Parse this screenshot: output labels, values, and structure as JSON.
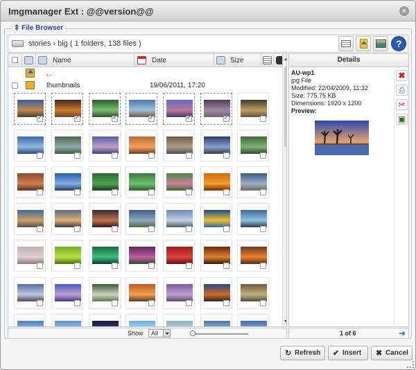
{
  "window": {
    "title": "Imgmanager Ext : @@version@@"
  },
  "browser": {
    "legend": "File Browser",
    "path": "stories › big ( 1 folders, 138 files )"
  },
  "columns": {
    "name": "Name",
    "date": "Date",
    "size": "Size"
  },
  "folders": {
    "up": "...",
    "thumbnails_name": "thumbnails",
    "thumbnails_date": "19/06/2011, 17:20"
  },
  "details": {
    "header": "Details",
    "name": "AU-wp1",
    "type": "jpg File",
    "modified": "Modified: 22/04/2009, 11:32",
    "size": "Size: 775.75 KB",
    "dimensions": "Dimensions: 1920 x 1200",
    "preview_label": "Preview:"
  },
  "status": {
    "show_label": "Show",
    "show_value": "All",
    "page": "1 of 6"
  },
  "buttons": {
    "refresh": "Refresh",
    "insert": "Insert",
    "cancel": "Cancel"
  },
  "colors": {
    "accent": "#1a4aa0",
    "delete": "#d42020"
  },
  "thumbnails": [
    {
      "g": [
        "#3a5d9c",
        "#c08a50",
        "#4a3a30"
      ],
      "sel": true
    },
    {
      "g": [
        "#3a2a1a",
        "#d07a30",
        "#6a4a20"
      ],
      "sel": true
    },
    {
      "g": [
        "#2a5a2a",
        "#7ac070",
        "#305030"
      ],
      "sel": true
    },
    {
      "g": [
        "#4a7ab0",
        "#a0c0d8",
        "#6a5a40"
      ],
      "sel": true
    },
    {
      "g": [
        "#5a6ac0",
        "#c07a9a",
        "#3a3a6a"
      ],
      "sel": true
    },
    {
      "g": [
        "#4a3a5a",
        "#a08aa0",
        "#706070"
      ],
      "sel": true
    },
    {
      "g": [
        "#3a3a2a",
        "#c0a060",
        "#605040"
      ],
      "sel": false
    },
    {
      "g": [
        "#3a6ab0",
        "#90b8e0",
        "#2a4a80"
      ],
      "sel": false
    },
    {
      "g": [
        "#4a6a4a",
        "#90a8b0",
        "#405a40"
      ],
      "sel": false
    },
    {
      "g": [
        "#5a5ab0",
        "#c0a0c0",
        "#404080"
      ],
      "sel": false
    },
    {
      "g": [
        "#c06a30",
        "#f0a060",
        "#6a3a20"
      ],
      "sel": false
    },
    {
      "g": [
        "#6a5a4a",
        "#b0a080",
        "#4a4a6a"
      ],
      "sel": false
    },
    {
      "g": [
        "#2a3a6a",
        "#8aa0d0",
        "#3a3a3a"
      ],
      "sel": false
    },
    {
      "g": [
        "#3a6a3a",
        "#80b070",
        "#2a4a2a"
      ],
      "sel": false
    },
    {
      "g": [
        "#8a4a30",
        "#d08050",
        "#5a3020"
      ],
      "sel": false
    },
    {
      "g": [
        "#2a5ab0",
        "#80b0e0",
        "#2a3a6a"
      ],
      "sel": false
    },
    {
      "g": [
        "#2a6a3a",
        "#50a050",
        "#1a3a1a"
      ],
      "sel": false
    },
    {
      "g": [
        "#3a7a3a",
        "#70c070",
        "#2a5a2a"
      ],
      "sel": false
    },
    {
      "g": [
        "#4a8a3a",
        "#d080a0",
        "#3a6a2a"
      ],
      "sel": false
    },
    {
      "g": [
        "#d06a10",
        "#f0a030",
        "#802a00"
      ],
      "sel": false
    },
    {
      "g": [
        "#3a5a8a",
        "#a0b0c0",
        "#6a6a6a"
      ],
      "sel": false
    },
    {
      "g": [
        "#3a6aa0",
        "#d0a060",
        "#505050"
      ],
      "sel": false
    },
    {
      "g": [
        "#5a6a8a",
        "#e0b070",
        "#3a3a4a"
      ],
      "sel": false
    },
    {
      "g": [
        "#3a2a2a",
        "#c07050",
        "#2a1a1a"
      ],
      "sel": false
    },
    {
      "g": [
        "#3a5a8a",
        "#90a8c0",
        "#4a6a3a"
      ],
      "sel": false
    },
    {
      "g": [
        "#6a8ab0",
        "#c0d0e0",
        "#4a5a70"
      ],
      "sel": false
    },
    {
      "g": [
        "#1a4a8a",
        "#f0c030",
        "#2a6aa0"
      ],
      "sel": false
    },
    {
      "g": [
        "#3a6aa0",
        "#90c0e0",
        "#2a3a4a"
      ],
      "sel": false
    },
    {
      "g": [
        "#c0b0b0",
        "#e0d0d0",
        "#8a7a7a"
      ],
      "sel": false
    },
    {
      "g": [
        "#6ab020",
        "#c0e040",
        "#3a7010"
      ],
      "sel": false
    },
    {
      "g": [
        "#1a6a3a",
        "#40c080",
        "#0a3a2a"
      ],
      "sel": false
    },
    {
      "g": [
        "#5a2a5a",
        "#c060a0",
        "#2a4a2a"
      ],
      "sel": false
    },
    {
      "g": [
        "#a01a1a",
        "#e04040",
        "#601010"
      ],
      "sel": false
    },
    {
      "g": [
        "#6a2a0a",
        "#e08030",
        "#2a1a0a"
      ],
      "sel": false
    },
    {
      "g": [
        "#6a3a1a",
        "#f08030",
        "#4a2a1a"
      ],
      "sel": false
    },
    {
      "g": [
        "#5a6aa0",
        "#c0c8e0",
        "#4a4a5a"
      ],
      "sel": false
    },
    {
      "g": [
        "#4a5ac0",
        "#c0a0d0",
        "#3a3a8a"
      ],
      "sel": false
    },
    {
      "g": [
        "#3a5a3a",
        "#d0d0c0",
        "#5a7a4a"
      ],
      "sel": false
    },
    {
      "g": [
        "#c05a20",
        "#f0a050",
        "#5a3a20"
      ],
      "sel": false
    },
    {
      "g": [
        "#7a5a9a",
        "#c0a0d0",
        "#5a4a6a"
      ],
      "sel": false
    },
    {
      "g": [
        "#2a4a8a",
        "#d06a20",
        "#2a2a2a"
      ],
      "sel": false
    },
    {
      "g": [
        "#6a5a3a",
        "#c0b080",
        "#4a4a3a"
      ],
      "sel": false
    },
    {
      "g": [
        "#4a80c0",
        "#a0c8f0",
        "#3a5aa0"
      ],
      "sel": false
    },
    {
      "g": [
        "#5a90d0",
        "#b0d0f0",
        "#3a6ab0"
      ],
      "sel": false
    },
    {
      "g": [
        "#1a1a3a",
        "#3a3a8a",
        "#0a0a2a"
      ],
      "sel": false
    },
    {
      "g": [
        "#60b0e0",
        "#c0e8f8",
        "#3a8ac0"
      ],
      "sel": false
    },
    {
      "g": [
        "#8ab0c0",
        "#d0e0e0",
        "#6a9aa0"
      ],
      "sel": false
    },
    {
      "g": [
        "#4a7ab0",
        "#a0c0e0",
        "#2a5a90"
      ],
      "sel": false
    },
    {
      "g": [
        "#3a6ab0",
        "#a0b8d8",
        "#2a4a80"
      ],
      "sel": false
    }
  ]
}
